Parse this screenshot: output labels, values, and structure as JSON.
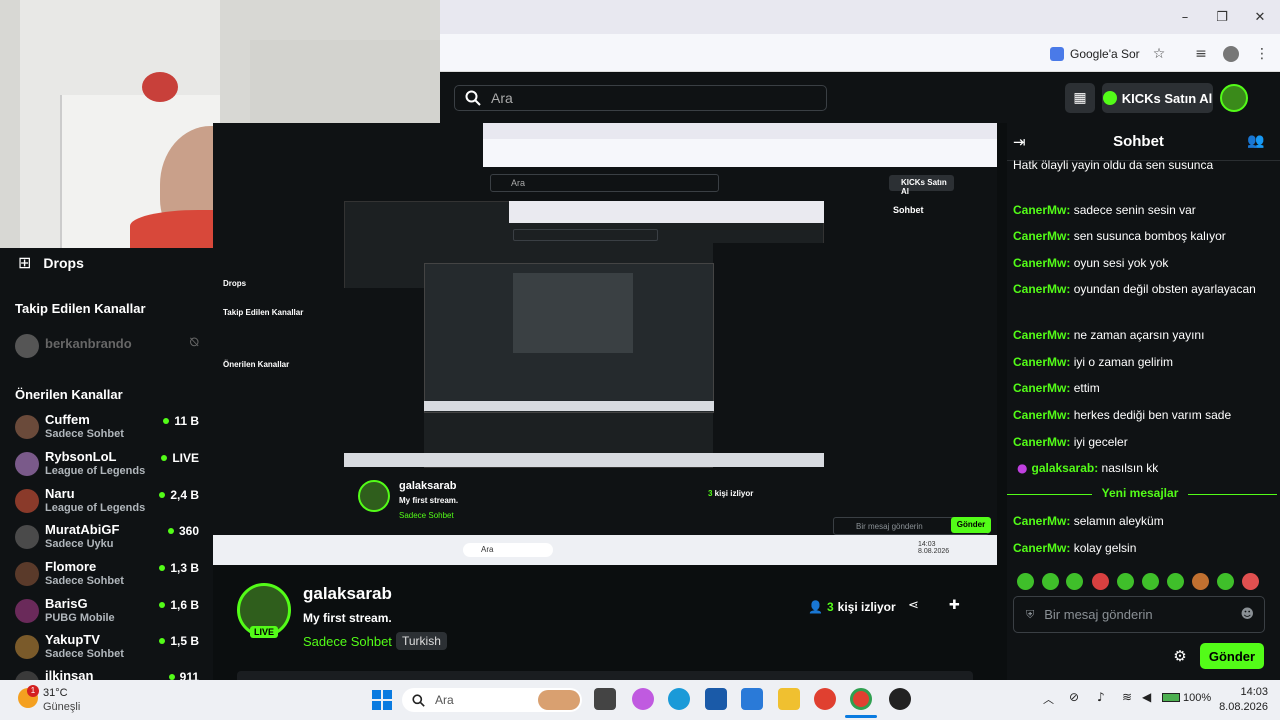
{
  "browser": {
    "google_sor": "Google'a Sor",
    "window_controls": [
      "minimize-icon",
      "maximize-icon",
      "close-icon"
    ]
  },
  "header": {
    "search_placeholder": "Ara",
    "kicks_label": "KICKs Satın Al"
  },
  "sidebar": {
    "drops_label": "Drops",
    "followed_title": "Takip Edilen Kanallar",
    "followed": [
      {
        "name": "berkanbrando"
      }
    ],
    "recommended_title": "Önerilen Kanallar",
    "recommended": [
      {
        "name": "Cuffem",
        "category": "Sadece Sohbet",
        "count": "11 B",
        "color": "#6a4a3a"
      },
      {
        "name": "RybsonLoL",
        "category": "League of Legends",
        "count": "LIVE",
        "color": "#7a5a8a"
      },
      {
        "name": "Naru",
        "category": "League of Legends",
        "count": "2,4 B",
        "color": "#8a3a2a"
      },
      {
        "name": "MuratAbiGF",
        "category": "Sadece Uyku",
        "count": "360",
        "color": "#4a4a4a"
      },
      {
        "name": "Flomore",
        "category": "Sadece Sohbet",
        "count": "1,3 B",
        "color": "#5a3a2a"
      },
      {
        "name": "BarisG",
        "category": "PUBG Mobile",
        "count": "1,6 B",
        "color": "#6a2a5a"
      },
      {
        "name": "YakupTV",
        "category": "Sadece Sohbet",
        "count": "1,5 B",
        "color": "#7a5a2a"
      },
      {
        "name": "ilkinsan",
        "category": "",
        "count": "911",
        "color": "#3a3a3a"
      }
    ]
  },
  "stream": {
    "live": "LIVE",
    "streamer": "galaksarab",
    "title": "My first stream.",
    "category": "Sadece Sohbet",
    "tag": "Turkish",
    "viewer_count": "3",
    "viewer_label": "kişi izliyor"
  },
  "chat": {
    "title": "Sohbet",
    "messages": [
      {
        "user": "",
        "text": "Hatk ölayli yayin oldu da sen susunca"
      },
      {
        "user": "CanerMw:",
        "text": "sadece senin sesin var"
      },
      {
        "user": "CanerMw:",
        "text": "sen susunca bomboş kalıyor"
      },
      {
        "user": "CanerMw:",
        "text": "oyun sesi yok yok"
      },
      {
        "user": "CanerMw:",
        "text": "oyundan değil obsten ayarlayacan"
      },
      {
        "user": "CanerMw:",
        "text": "ne zaman açarsın yayını"
      },
      {
        "user": "CanerMw:",
        "text": "iyi o zaman gelirim"
      },
      {
        "user": "CanerMw:",
        "text": "ettim"
      },
      {
        "user": "CanerMw:",
        "text": "herkes dediği ben varım sade"
      },
      {
        "user": "CanerMw:",
        "text": "iyi geceler"
      },
      {
        "user": "galaksarab:",
        "text": "nasılsın kk"
      },
      {
        "user": "CanerMw:",
        "text": "selamın aleyküm"
      },
      {
        "user": "CanerMw:",
        "text": "kolay gelsin"
      }
    ],
    "new_messages": "Yeni mesajlar",
    "input_placeholder": "Bir mesaj gönderin",
    "send_label": "Gönder"
  },
  "taskbar": {
    "weather_temp": "31°C",
    "weather_desc": "Güneşli",
    "weather_badge": "1",
    "search_placeholder": "Ara",
    "battery": "100%",
    "time": "14:03",
    "date": "8.08.2026"
  }
}
